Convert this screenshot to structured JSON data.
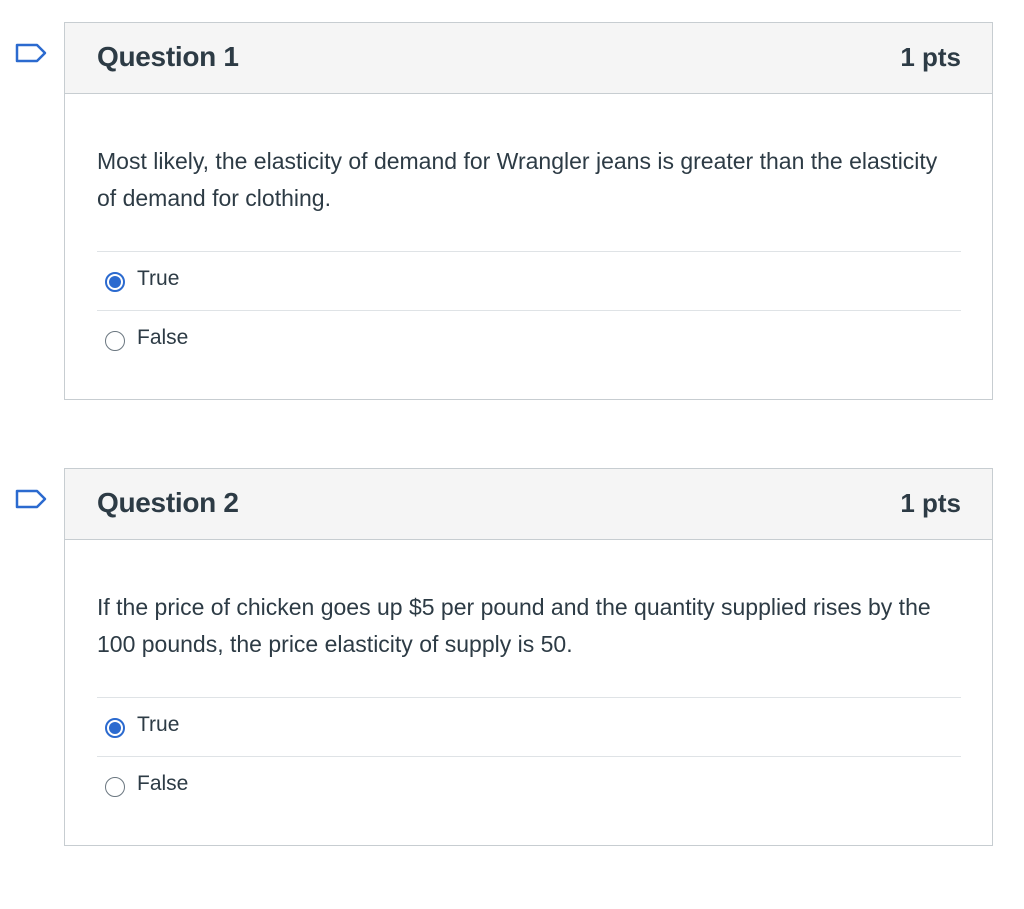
{
  "questions": [
    {
      "title": "Question 1",
      "points": "1 pts",
      "text": "Most likely, the elasticity of demand for Wrangler jeans is greater than the elasticity of demand for clothing.",
      "answers": [
        {
          "label": "True",
          "selected": true
        },
        {
          "label": "False",
          "selected": false
        }
      ]
    },
    {
      "title": "Question 2",
      "points": "1 pts",
      "text": "If the price of chicken goes up $5 per pound and the quantity supplied rises by the 100 pounds, the price elasticity of supply is 50.",
      "answers": [
        {
          "label": "True",
          "selected": true
        },
        {
          "label": "False",
          "selected": false
        }
      ]
    }
  ],
  "colors": {
    "accent": "#2b6acf",
    "header_bg": "#f5f5f5",
    "border": "#c7cdd1",
    "text": "#2d3b45"
  },
  "icons": {
    "flag": "flag-question-icon"
  }
}
